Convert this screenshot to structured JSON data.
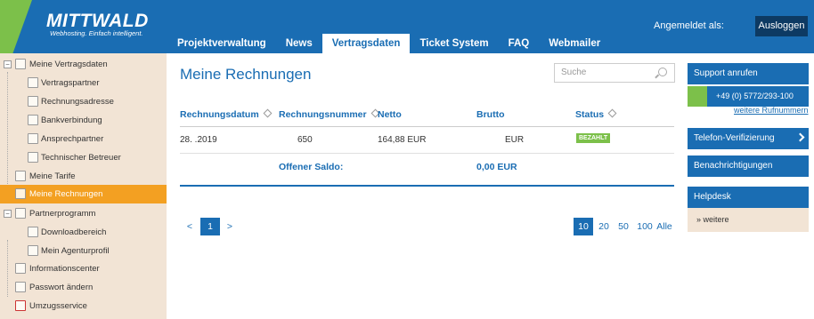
{
  "brand": {
    "name": "MITTWALD",
    "tagline": "Webhosting. Einfach intelligent.",
    "color_primary": "#1a6db3",
    "color_accent": "#7cc04a",
    "color_active": "#f3a022"
  },
  "nav": {
    "tabs": [
      "Projektverwaltung",
      "News",
      "Vertragsdaten",
      "Ticket System",
      "FAQ",
      "Webmailer"
    ],
    "active": "Vertragsdaten"
  },
  "header": {
    "logged_in_label": "Angemeldet als:",
    "logout_label": "Ausloggen"
  },
  "sidebar": {
    "items": [
      {
        "label": "Meine Vertragsdaten",
        "icon": "document-icon"
      },
      {
        "label": "Vertragspartner",
        "icon": "contract-icon"
      },
      {
        "label": "Rechnungsadresse",
        "icon": "address-icon"
      },
      {
        "label": "Bankverbindung",
        "icon": "bank-icon"
      },
      {
        "label": "Ansprechpartner",
        "icon": "person-icon"
      },
      {
        "label": "Technischer Betreuer",
        "icon": "technician-icon"
      },
      {
        "label": "Meine Tarife",
        "icon": "tariff-icon"
      },
      {
        "label": "Meine Rechnungen",
        "icon": "invoice-icon"
      },
      {
        "label": "Partnerprogramm",
        "icon": "partner-icon"
      },
      {
        "label": "Downloadbereich",
        "icon": "download-icon"
      },
      {
        "label": "Mein Agenturprofil",
        "icon": "profile-icon"
      },
      {
        "label": "Informationscenter",
        "icon": "info-icon"
      },
      {
        "label": "Passwort ändern",
        "icon": "lock-icon"
      },
      {
        "label": "Umzugsservice",
        "icon": "calendar-icon"
      }
    ]
  },
  "main": {
    "title": "Meine Rechnungen",
    "search_placeholder": "Suche",
    "columns": [
      "Rechnungsdatum",
      "Rechnungsnummer",
      "Netto",
      "Brutto",
      "Status"
    ],
    "rows": [
      {
        "date": "28.     .2019",
        "number": "650",
        "netto": "164,88 EUR",
        "brutto": "EUR",
        "status": "BEZAHLT"
      }
    ],
    "saldo_label": "Offener Saldo:",
    "saldo_value": "0,00 EUR",
    "pagination": {
      "prev": "<",
      "current": "1",
      "next": ">"
    },
    "page_sizes": [
      "10",
      "20",
      "50",
      "100",
      "Alle"
    ],
    "page_size_selected": "10"
  },
  "right": {
    "support_title": "Support anrufen",
    "phone": "+49 (0) 5772/293-100",
    "more_numbers": "weitere Rufnummern",
    "telefon_verif": "Telefon-Verifizierung",
    "notifications": "Benachrichtigungen",
    "helpdesk": "Helpdesk",
    "weiter": "» weitere"
  }
}
